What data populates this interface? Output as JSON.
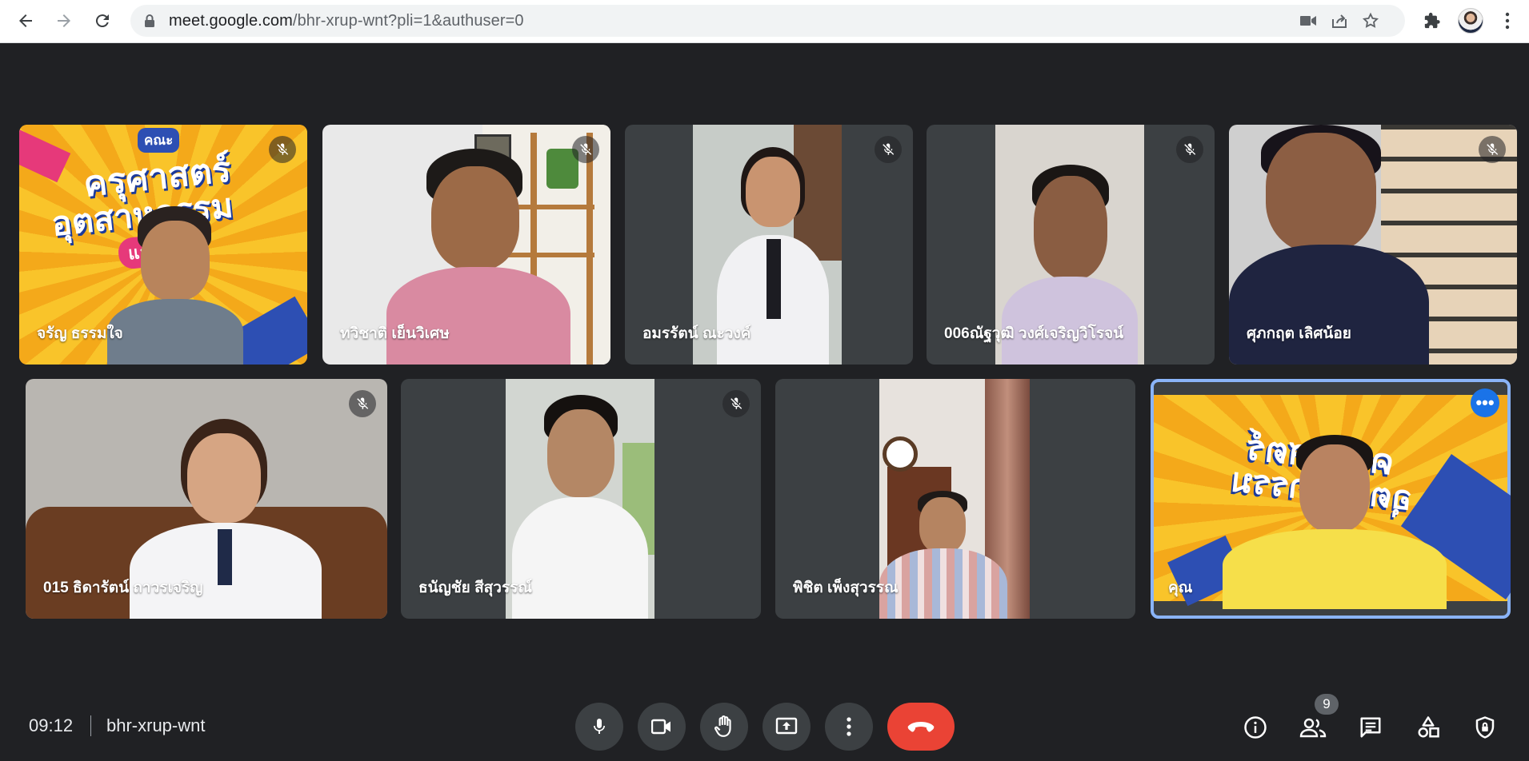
{
  "browser": {
    "url_host": "meet.google.com",
    "url_path": "/bhr-xrup-wnt?pli=1&authuser=0"
  },
  "participants": [
    {
      "name": "จรัญ ธรรมใจ",
      "muted": true
    },
    {
      "name": "ทวิชาติ เย็นวิเศษ",
      "muted": true
    },
    {
      "name": "อมรรัตน์ ณะวงค์",
      "muted": true
    },
    {
      "name": "006ณัฐวุฒิ วงศ์เจริญวิโรจน์",
      "muted": true
    },
    {
      "name": "ศุภกฤต เลิศน้อย",
      "muted": true
    },
    {
      "name": "015 ธิดารัตน์ ถาวรเจริญ",
      "muted": true
    },
    {
      "name": "ธนัญชัย สีสุวรรณ์",
      "muted": true
    },
    {
      "name": "พิชิต เพ็งสุวรรณ",
      "muted": false
    },
    {
      "name": "คุณ",
      "muted": false,
      "self": true
    }
  ],
  "banner_text": {
    "line1": "คณะ",
    "line2": "ครุศาสตร์",
    "line3": "อุตสาหกรรม",
    "line4": "และ...ยี"
  },
  "meeting": {
    "time": "09:12",
    "code": "bhr-xrup-wnt",
    "participant_count": "9"
  },
  "colors": {
    "background": "#202124",
    "tile": "#3c4043",
    "hangup": "#ea4335",
    "self_outline": "#8ab4f8",
    "accent_blue": "#1a73e8"
  }
}
